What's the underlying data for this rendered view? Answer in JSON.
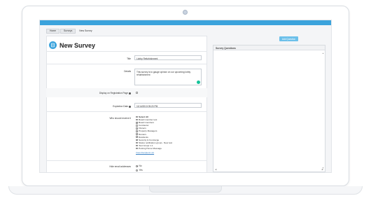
{
  "breadcrumb": [
    "Home",
    "Surveys",
    "New Survey"
  ],
  "page": {
    "title": "New Survey"
  },
  "add_question": {
    "label": "Add Question"
  },
  "survey_questions": {
    "title": "Survey Questions"
  },
  "form": {
    "title_label": "Title",
    "title_value": "Lobby Refurbishment",
    "details_label": "Details",
    "details_value": "This survey is to gauge opinion on our upcoming lobby refurbishment",
    "display_label": "Display on Registration Page",
    "expiration_label": "Expiration Date",
    "expiration_value": "11/14/2013 05:20 PM",
    "roles_label": "Who should receive it",
    "roles": [
      {
        "label": "Select All",
        "checked": false
      },
      {
        "label": "Board member test",
        "checked": false
      },
      {
        "label": "Board members",
        "checked": true
      },
      {
        "label": "Contractor",
        "checked": false
      },
      {
        "label": "Owners",
        "checked": true
      },
      {
        "label": "Property Managers",
        "checked": true
      },
      {
        "label": "Renters",
        "checked": true
      },
      {
        "label": "Residents",
        "checked": true
      },
      {
        "label": "Security & Concierge",
        "checked": true
      },
      {
        "label": "Status notification group - New test",
        "checked": false
      },
      {
        "label": "Test Group 1.1",
        "checked": false
      },
      {
        "label": "Posting Home Message",
        "checked": false
      }
    ],
    "recipient_link": "View Recipient List",
    "hide_label": "Hide email addresses",
    "hide_options": [
      "No",
      "Yes"
    ]
  }
}
